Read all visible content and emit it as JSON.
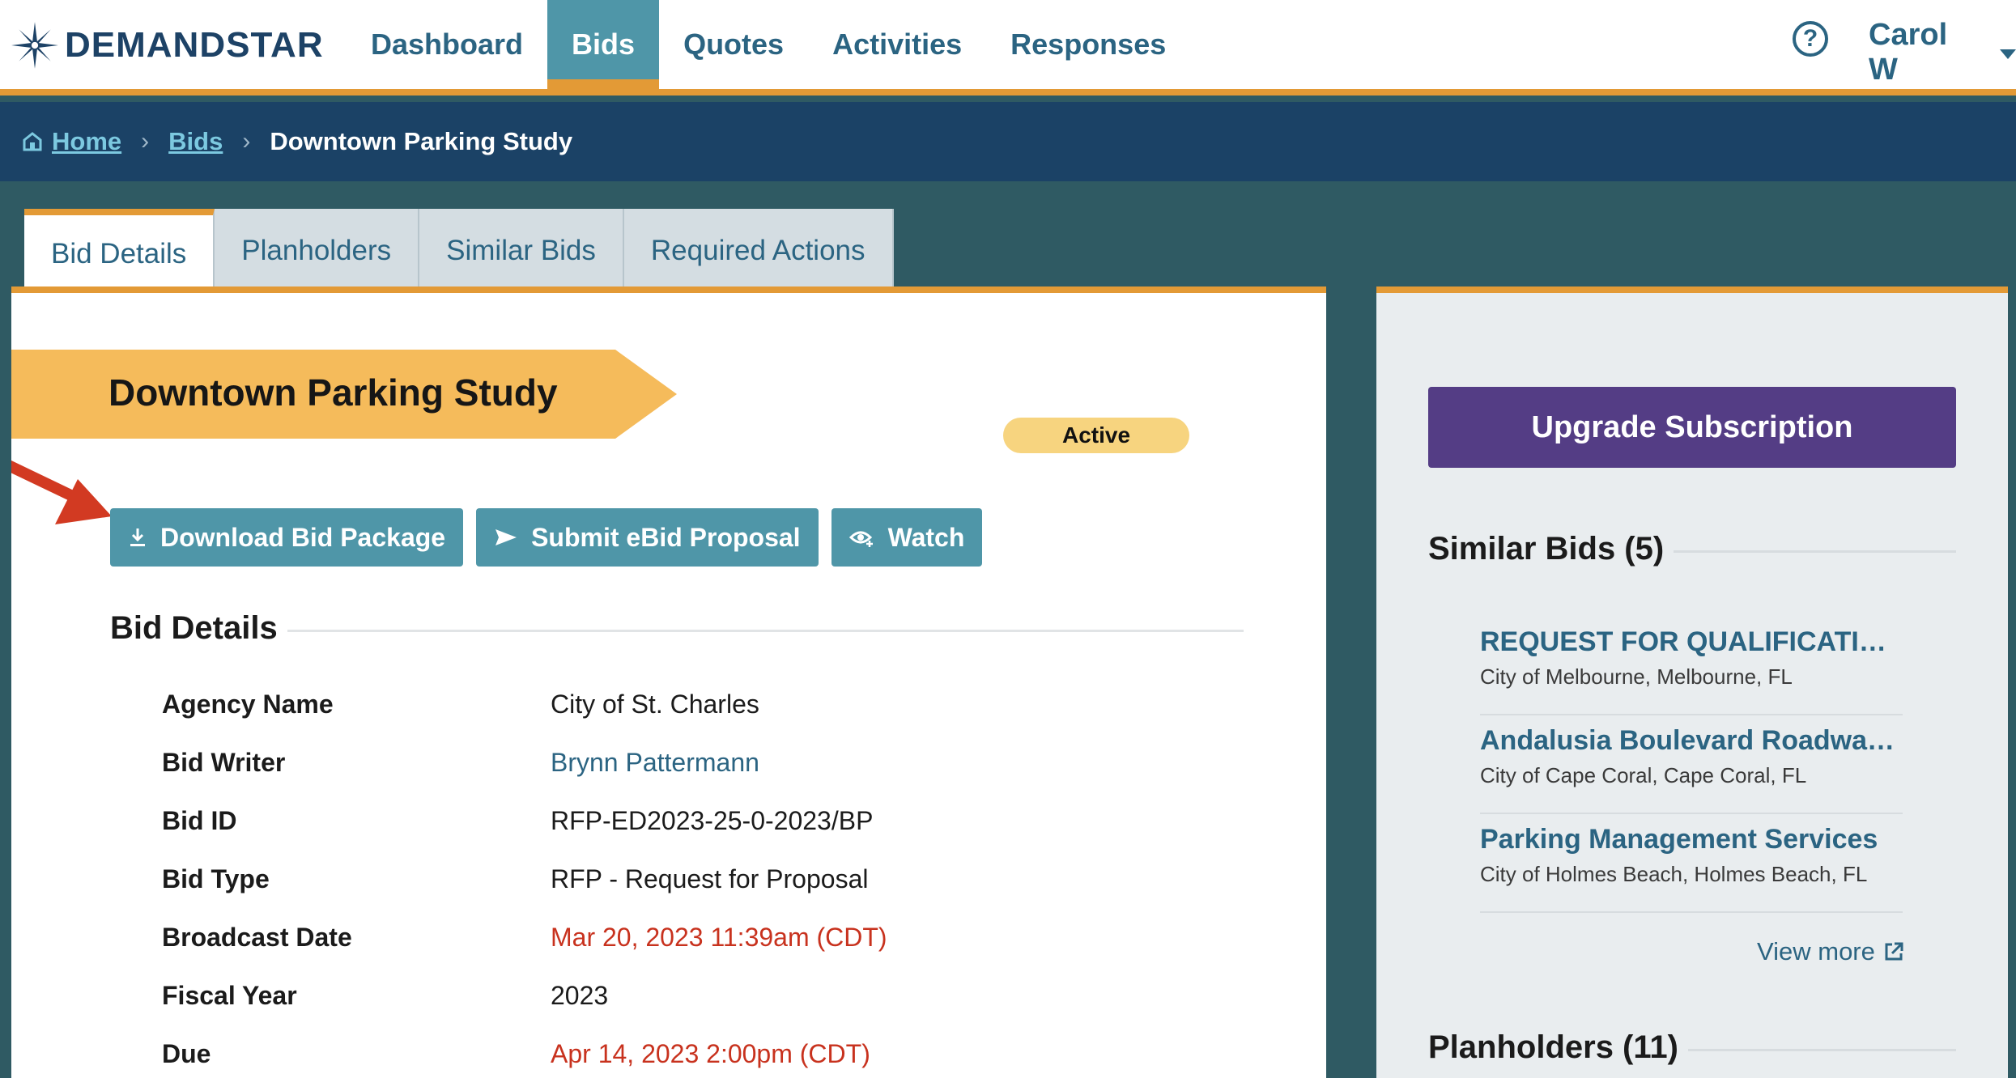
{
  "brand": {
    "name": "DEMANDSTAR"
  },
  "nav": {
    "items": [
      {
        "label": "Dashboard",
        "active": false
      },
      {
        "label": "Bids",
        "active": true
      },
      {
        "label": "Quotes",
        "active": false
      },
      {
        "label": "Activities",
        "active": false
      },
      {
        "label": "Responses",
        "active": false
      }
    ],
    "help_icon_glyph": "?",
    "user_name": "Carol W"
  },
  "breadcrumb": {
    "home": "Home",
    "bids": "Bids",
    "current": "Downtown Parking Study",
    "separator": "›"
  },
  "tabs": [
    {
      "label": "Bid Details",
      "active": true
    },
    {
      "label": "Planholders",
      "active": false
    },
    {
      "label": "Similar Bids",
      "active": false
    },
    {
      "label": "Required Actions",
      "active": false
    }
  ],
  "bid": {
    "title": "Downtown Parking Study",
    "status": "Active",
    "actions": {
      "download": "Download Bid Package",
      "submit": "Submit eBid Proposal",
      "watch": "Watch"
    },
    "section_title": "Bid Details",
    "details": [
      {
        "label": "Agency Name",
        "value": "City of St. Charles",
        "style": "plain"
      },
      {
        "label": "Bid Writer",
        "value": "Brynn Pattermann",
        "style": "link"
      },
      {
        "label": "Bid ID",
        "value": "RFP-ED2023-25-0-2023/BP",
        "style": "plain"
      },
      {
        "label": "Bid Type",
        "value": "RFP - Request for Proposal",
        "style": "plain"
      },
      {
        "label": "Broadcast Date",
        "value": "Mar 20, 2023 11:39am (CDT)",
        "style": "red"
      },
      {
        "label": "Fiscal Year",
        "value": "2023",
        "style": "plain"
      },
      {
        "label": "Due",
        "value": "Apr 14, 2023 2:00pm (CDT)",
        "style": "red"
      }
    ]
  },
  "sidebar": {
    "upgrade_label": "Upgrade Subscription",
    "similar_title": "Similar Bids (5)",
    "similar_bids": [
      {
        "title": "REQUEST FOR QUALIFICATIONS…",
        "location": "City of Melbourne, Melbourne, FL"
      },
      {
        "title": "Andalusia Boulevard Roadway …",
        "location": "City of Cape Coral, Cape Coral, FL"
      },
      {
        "title": "Parking Management Services",
        "location": "City of Holmes Beach, Holmes Beach, FL"
      }
    ],
    "view_more": "View more",
    "planholders_title": "Planholders (11)"
  },
  "colors": {
    "accent_orange": "#e39a36",
    "nav_teal": "#4f96a8",
    "header_navy": "#1b4266",
    "upgrade_purple": "#543d85",
    "status_yellow": "#f7d47f",
    "alert_red": "#c8321e",
    "pointer_red": "#d23a22"
  }
}
